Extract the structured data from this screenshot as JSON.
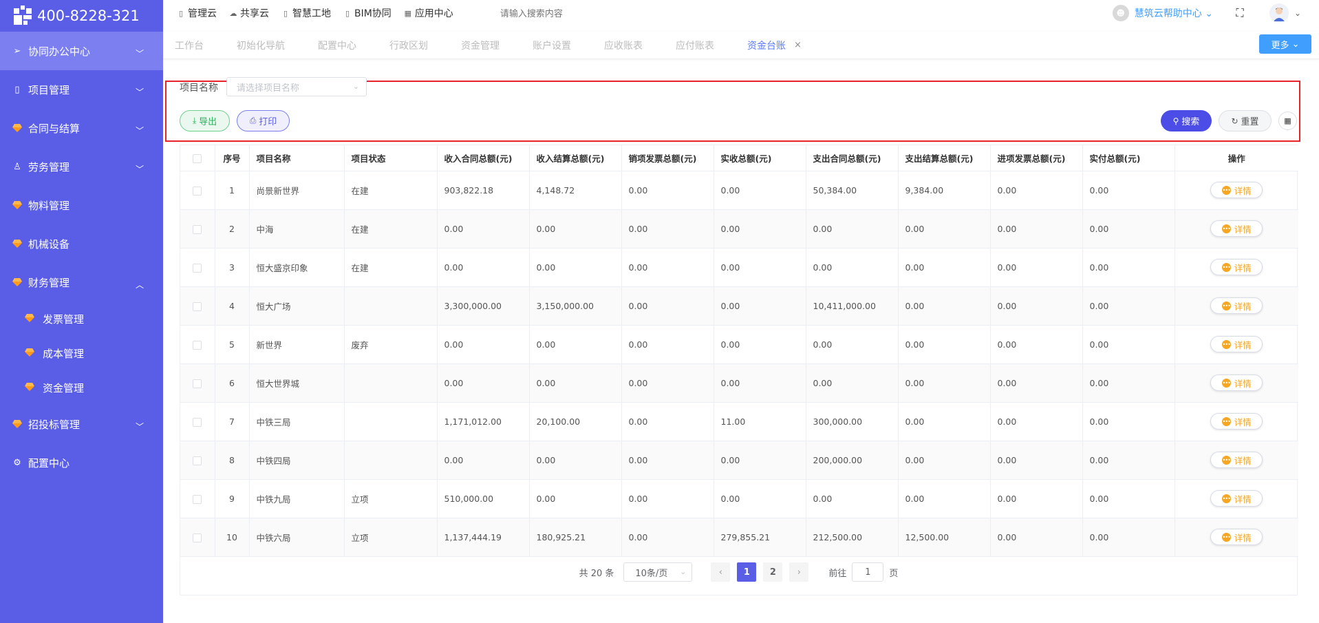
{
  "brand": {
    "phone": "400-8228-321"
  },
  "sidebar": {
    "items": [
      {
        "label": "协同办公中心",
        "icon": "send-icon",
        "has_chevron": true,
        "active": true
      },
      {
        "label": "项目管理",
        "icon": "book-icon",
        "has_chevron": true
      },
      {
        "label": "合同与结算",
        "icon": "gem-icon",
        "has_chevron": true
      },
      {
        "label": "劳务管理",
        "icon": "user-icon",
        "has_chevron": true
      },
      {
        "label": "物料管理",
        "icon": "gem-icon",
        "has_chevron": false
      },
      {
        "label": "机械设备",
        "icon": "gem-icon",
        "has_chevron": false
      },
      {
        "label": "财务管理",
        "icon": "gem-icon",
        "has_chevron": true,
        "expanded": true
      },
      {
        "label": "招投标管理",
        "icon": "gem-icon",
        "has_chevron": true
      },
      {
        "label": "配置中心",
        "icon": "gear-icon",
        "has_chevron": false
      }
    ],
    "finance_sub": [
      {
        "label": "发票管理"
      },
      {
        "label": "成本管理"
      },
      {
        "label": "资金管理"
      }
    ]
  },
  "topnav": {
    "items": [
      {
        "label": "管理云",
        "icon": "doc-icon"
      },
      {
        "label": "共享云",
        "icon": "cloud-icon"
      },
      {
        "label": "智慧工地",
        "icon": "doc-icon"
      },
      {
        "label": "BIM协同",
        "icon": "doc-icon"
      },
      {
        "label": "应用中心",
        "icon": "grid-icon"
      }
    ],
    "search_placeholder": "请输入搜索内容",
    "help_label": "慧筑云帮助中心"
  },
  "tabs": {
    "items": [
      "工作台",
      "初始化导航",
      "配置中心",
      "行政区划",
      "资金管理",
      "账户设置",
      "应收账表",
      "应付账表"
    ],
    "active": "资金台账",
    "close": "×",
    "more_label": "更多"
  },
  "filter": {
    "label": "项目名称",
    "placeholder": "请选择项目名称",
    "export_label": "导出",
    "print_label": "打印",
    "search_label": "搜索",
    "reset_label": "重置"
  },
  "table": {
    "columns": [
      "序号",
      "项目名称",
      "项目状态",
      "收入合同总额(元)",
      "收入结算总额(元)",
      "销项发票总额(元)",
      "实收总额(元)",
      "支出合同总额(元)",
      "支出结算总额(元)",
      "进项发票总额(元)",
      "实付总额(元)",
      "操作"
    ],
    "detail_label": "详情",
    "rows": [
      [
        "1",
        "尚景新世界",
        "在建",
        "903,822.18",
        "4,148.72",
        "0.00",
        "0.00",
        "50,384.00",
        "9,384.00",
        "0.00",
        "0.00"
      ],
      [
        "2",
        "中海",
        "在建",
        "0.00",
        "0.00",
        "0.00",
        "0.00",
        "0.00",
        "0.00",
        "0.00",
        "0.00"
      ],
      [
        "3",
        "恒大盛京印象",
        "在建",
        "0.00",
        "0.00",
        "0.00",
        "0.00",
        "0.00",
        "0.00",
        "0.00",
        "0.00"
      ],
      [
        "4",
        "恒大广场",
        "",
        "3,300,000.00",
        "3,150,000.00",
        "0.00",
        "0.00",
        "10,411,000.00",
        "0.00",
        "0.00",
        "0.00"
      ],
      [
        "5",
        "新世界",
        "废弃",
        "0.00",
        "0.00",
        "0.00",
        "0.00",
        "0.00",
        "0.00",
        "0.00",
        "0.00"
      ],
      [
        "6",
        "恒大世界城",
        "",
        "0.00",
        "0.00",
        "0.00",
        "0.00",
        "0.00",
        "0.00",
        "0.00",
        "0.00"
      ],
      [
        "7",
        "中铁三局",
        "",
        "1,171,012.00",
        "20,100.00",
        "0.00",
        "11.00",
        "300,000.00",
        "0.00",
        "0.00",
        "0.00"
      ],
      [
        "8",
        "中铁四局",
        "",
        "0.00",
        "0.00",
        "0.00",
        "0.00",
        "200,000.00",
        "0.00",
        "0.00",
        "0.00"
      ],
      [
        "9",
        "中铁九局",
        "立项",
        "510,000.00",
        "0.00",
        "0.00",
        "0.00",
        "0.00",
        "0.00",
        "0.00",
        "0.00"
      ],
      [
        "10",
        "中铁六局",
        "立项",
        "1,137,444.19",
        "180,925.21",
        "0.00",
        "279,855.21",
        "212,500.00",
        "12,500.00",
        "0.00",
        "0.00"
      ]
    ]
  },
  "pagination": {
    "total_text": "共 20 条",
    "page_size": "10条/页",
    "pages": [
      "1",
      "2"
    ],
    "current": "1",
    "goto_prefix": "前往",
    "goto_value": "1",
    "goto_suffix": "页"
  },
  "colors": {
    "sidebar_bg": "#5a5ee6",
    "sidebar_active": "#7b7ff0",
    "accent_blue": "#409eff",
    "highlight_border": "#e6232b",
    "detail_orange": "#f5a623"
  }
}
